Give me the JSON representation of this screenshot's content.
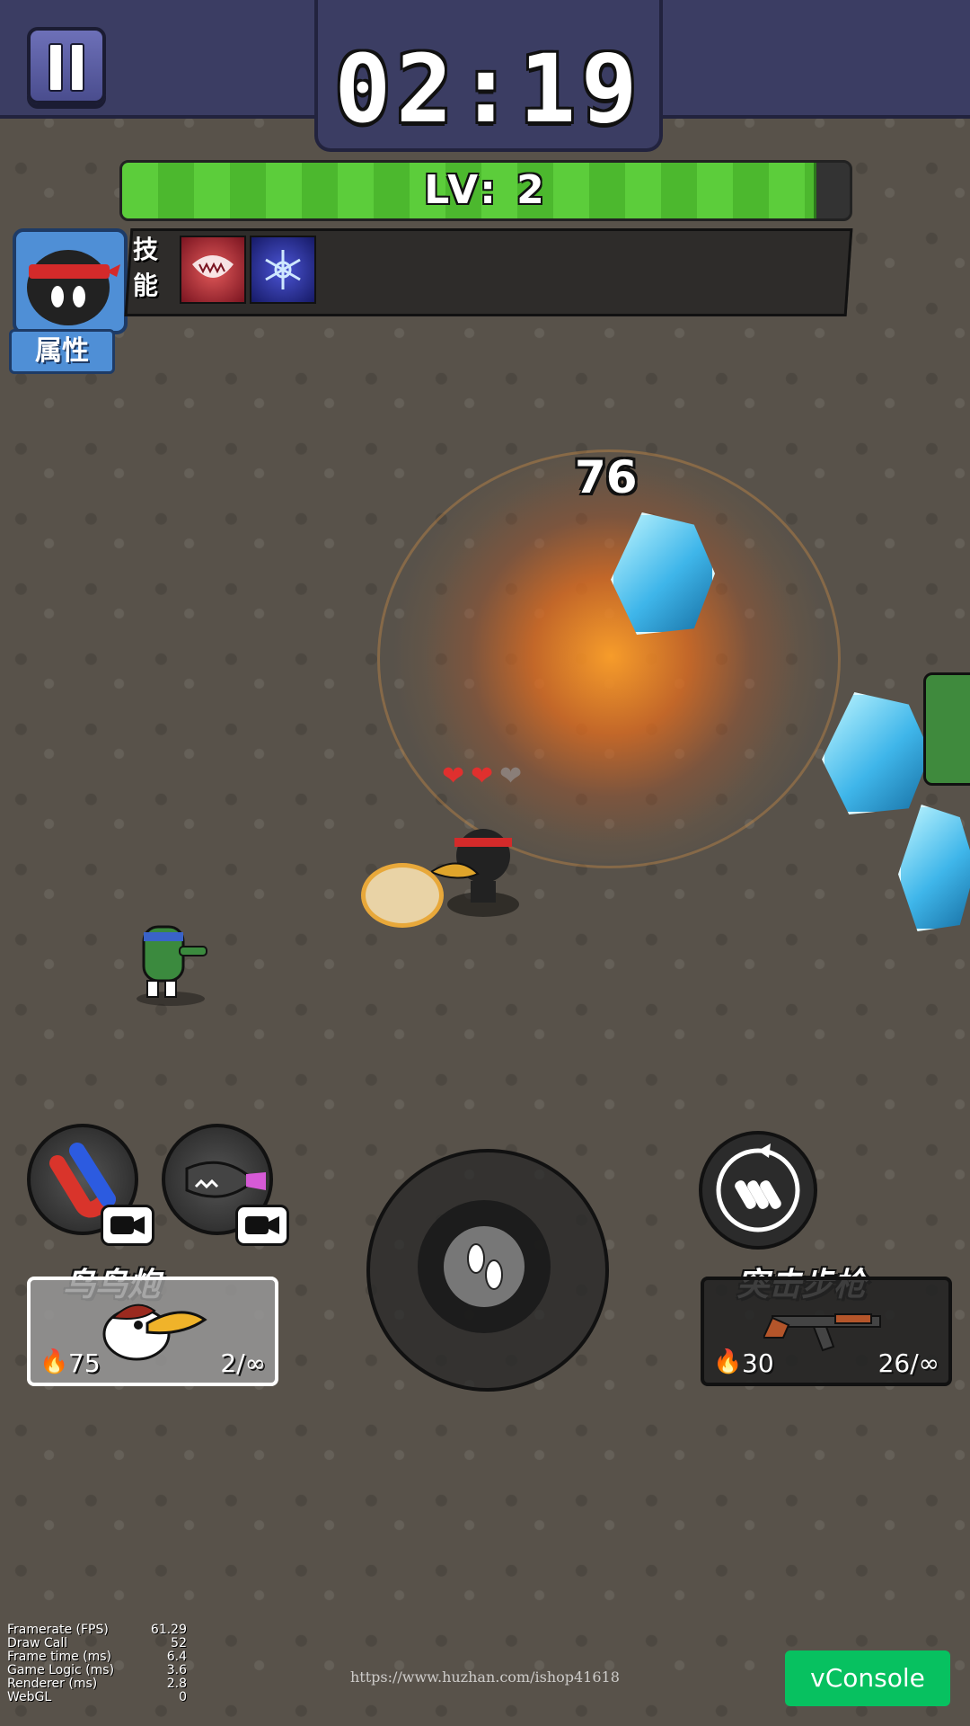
{
  "hud": {
    "timer": "02:19",
    "level_text": "LV: 2",
    "level_progress": 0.95
  },
  "panel": {
    "attributes_label": "属性",
    "skills_label_1": "技",
    "skills_label_2": "能",
    "skills": [
      {
        "icon": "fanged-mouth-icon",
        "color": "#a3202a"
      },
      {
        "icon": "snowflake-icon",
        "color": "#2a2f9e"
      }
    ]
  },
  "combat": {
    "damage_number": "76",
    "hearts_full": 2,
    "hearts_total": 3
  },
  "abilities": [
    {
      "icon": "magnet-icon"
    },
    {
      "icon": "bullet-shark-icon"
    }
  ],
  "weapons": {
    "left": {
      "name": "鸟鸟炮",
      "power": "75",
      "ammo": "2/∞",
      "icon": "bird-cannon-icon"
    },
    "right": {
      "name": "突击步枪",
      "power": "30",
      "ammo": "26/∞",
      "icon": "assault-rifle-icon"
    }
  },
  "debug": {
    "rows": [
      {
        "label": "Framerate (FPS)",
        "value": "61.29"
      },
      {
        "label": "Draw Call",
        "value": "52"
      },
      {
        "label": "Frame time (ms)",
        "value": "6.4"
      },
      {
        "label": "Game Logic (ms)",
        "value": "3.6"
      },
      {
        "label": "Renderer (ms)",
        "value": "2.8"
      },
      {
        "label": "WebGL",
        "value": "0"
      }
    ]
  },
  "watermark": "https://www.huzhan.com/ishop41618",
  "vconsole_label": "vConsole",
  "colors": {
    "topbar": "#3b3d63",
    "level_bar": "#5ccd3b",
    "vconsole": "#07c160"
  }
}
